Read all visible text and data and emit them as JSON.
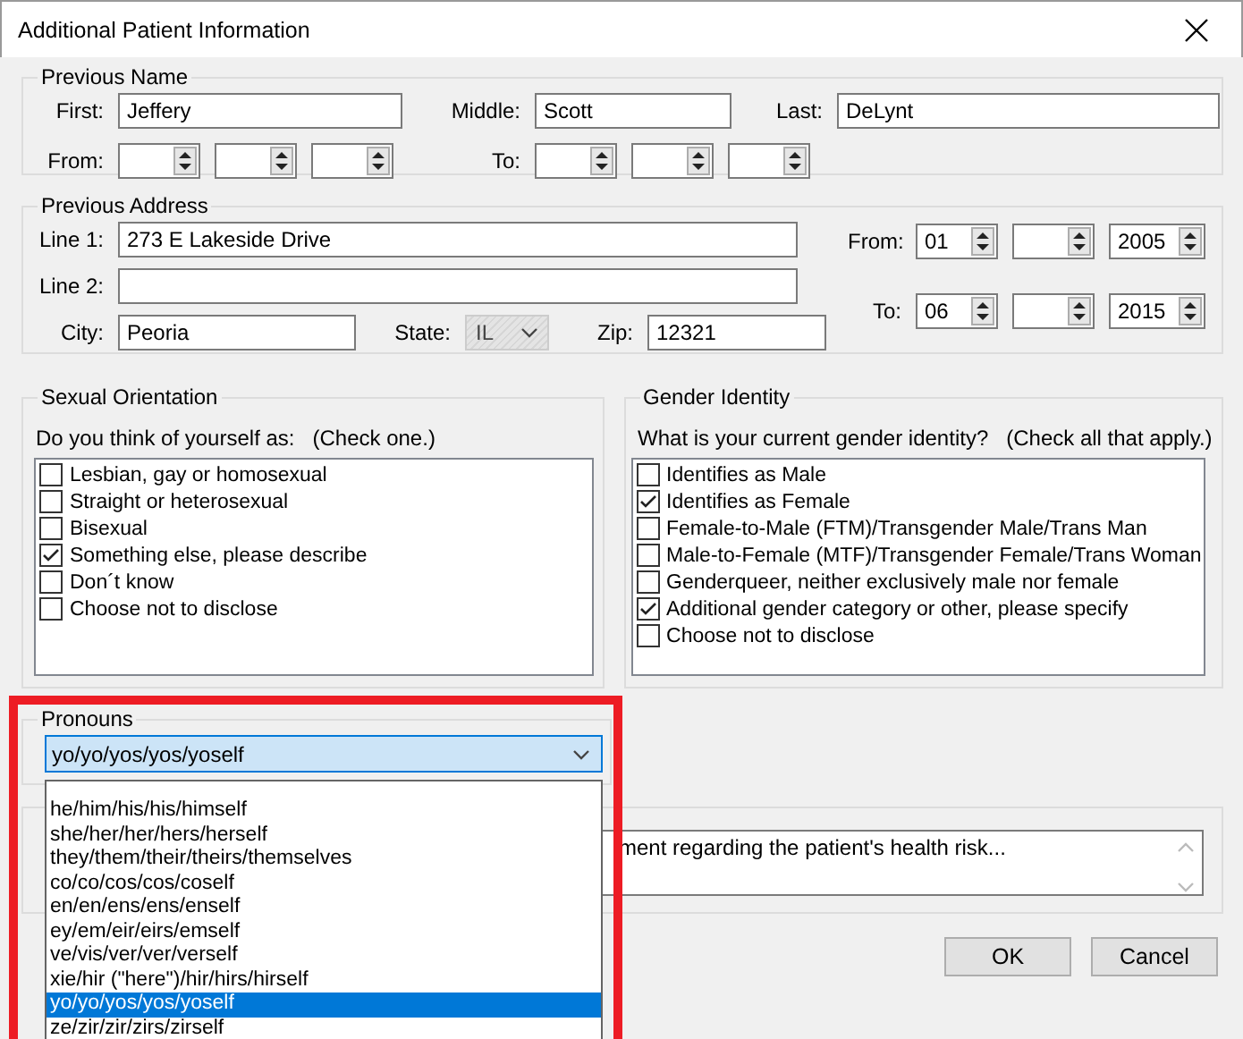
{
  "window": {
    "title": "Additional Patient Information"
  },
  "previous_name": {
    "title": "Previous Name",
    "fields": [
      {
        "label": "First:",
        "value": "Jeffery"
      },
      {
        "label": "Middle:",
        "value": "Scott"
      },
      {
        "label": "Last:",
        "value": "DeLynt"
      }
    ],
    "from": {
      "label": "From:"
    },
    "to": {
      "label": "To:"
    }
  },
  "previous_address": {
    "title": "Previous Address",
    "line1": {
      "label": "Line 1:",
      "value": "273 E Lakeside Drive"
    },
    "line2": {
      "label": "Line 2:"
    },
    "city": {
      "label": "City:",
      "value": "Peoria"
    },
    "state": {
      "label": "State:",
      "value": "IL"
    },
    "zip": {
      "label": "Zip:",
      "value": "12321"
    },
    "from": {
      "label": "From:",
      "month": "01",
      "year": "2005"
    },
    "to": {
      "label": "To:",
      "month": "06",
      "year": "2015"
    }
  },
  "sexual_orientation": {
    "title": "Sexual Orientation",
    "question": "Do you think of yourself as:   (Check one.)",
    "items": [
      {
        "label": "Lesbian, gay or homosexual",
        "checked": false
      },
      {
        "label": "Straight or heterosexual",
        "checked": false
      },
      {
        "label": "Bisexual",
        "checked": false
      },
      {
        "label": "Something else, please describe",
        "checked": true
      },
      {
        "label": "Don´t know",
        "checked": false
      },
      {
        "label": "Choose not to disclose",
        "checked": false
      }
    ]
  },
  "gender_identity": {
    "title": "Gender Identity",
    "question": "What is your current gender identity?   (Check all that apply.)",
    "items": [
      {
        "label": "Identifies as Male",
        "checked": false
      },
      {
        "label": "Identifies as Female",
        "checked": true
      },
      {
        "label": "Female-to-Male (FTM)/Transgender Male/Trans Man",
        "checked": false
      },
      {
        "label": "Male-to-Female  (MTF)/Transgender Female/Trans  Woman",
        "checked": false
      },
      {
        "label": "Genderqueer, neither exclusively male nor female",
        "checked": false
      },
      {
        "label": "Additional gender category or other, please specify",
        "checked": true
      },
      {
        "label": "Choose not to disclose",
        "checked": false
      }
    ]
  },
  "pronouns": {
    "title": "Pronouns",
    "value": "yo/yo/yos/yos/yoself",
    "options": [
      {
        "label": "he/him/his/his/himself",
        "selected": false
      },
      {
        "label": "she/her/her/hers/herself",
        "selected": false
      },
      {
        "label": "they/them/their/theirs/themselves",
        "selected": false
      },
      {
        "label": "co/co/cos/cos/coself",
        "selected": false
      },
      {
        "label": "en/en/ens/ens/enself",
        "selected": false
      },
      {
        "label": "ey/em/eir/eirs/emself",
        "selected": false
      },
      {
        "label": "ve/vis/ver/ver/verself",
        "selected": false
      },
      {
        "label": "xie/hir (\"here\")/hir/hirs/hirself",
        "selected": false
      },
      {
        "label": "yo/yo/yos/yos/yoself",
        "selected": true
      },
      {
        "label": "ze/zir/zir/zirs/zirself",
        "selected": false
      }
    ]
  },
  "notes": {
    "text": "ment regarding the patient's health risk..."
  },
  "buttons": [
    "OK",
    "Cancel"
  ]
}
